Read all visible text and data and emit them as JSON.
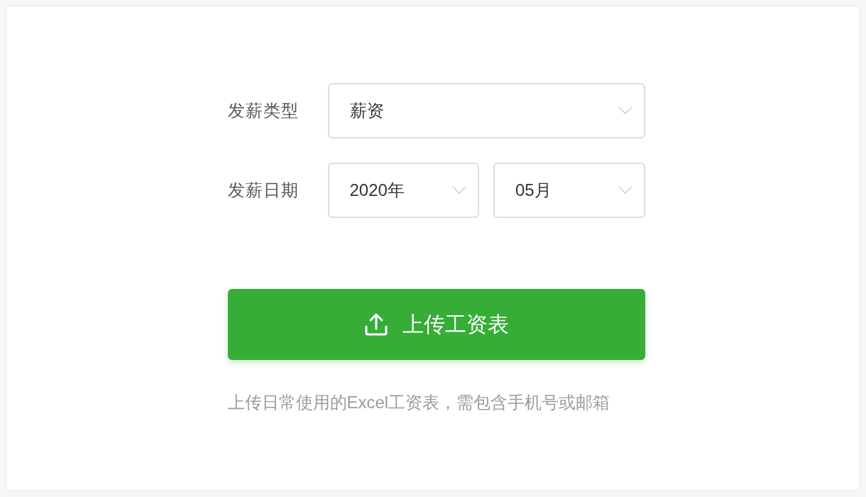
{
  "form": {
    "rows": [
      {
        "label": "发薪类型",
        "selects": [
          {
            "value": "薪资"
          }
        ]
      },
      {
        "label": "发薪日期",
        "selects": [
          {
            "value": "2020年"
          },
          {
            "value": "05月"
          }
        ]
      }
    ]
  },
  "upload_button": {
    "label": "上传工资表"
  },
  "hint": "上传日常使用的Excel工资表，需包含手机号或邮箱"
}
